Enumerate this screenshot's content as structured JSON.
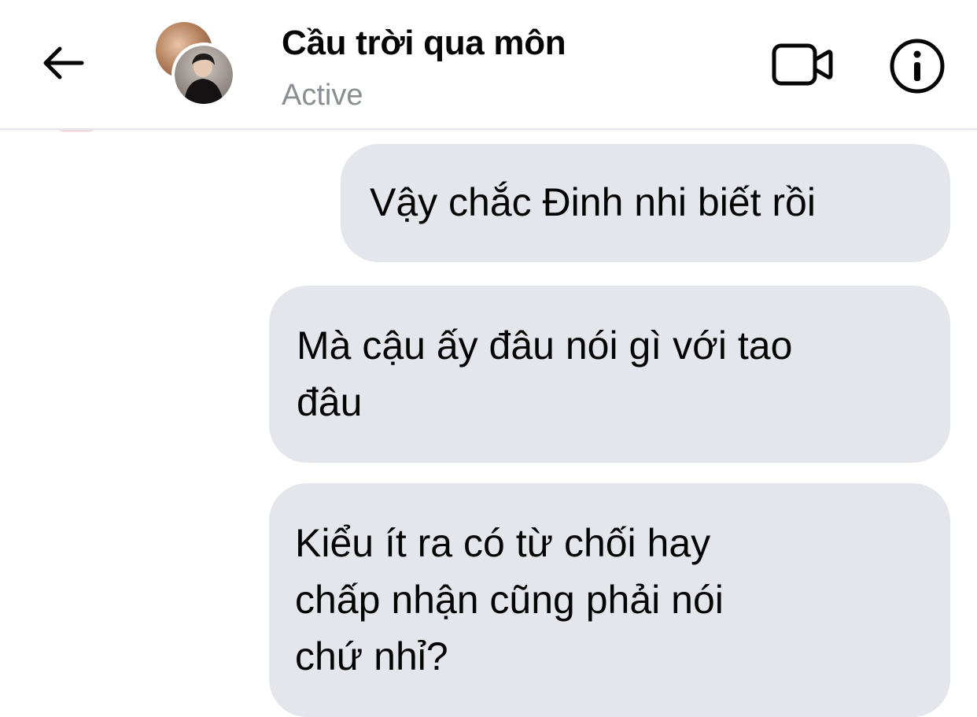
{
  "header": {
    "title": "Cầu trời qua môn",
    "status": "Active",
    "back_icon": "arrow-left-icon",
    "video_icon": "video-camera-icon",
    "info_icon": "info-icon"
  },
  "messages": [
    {
      "sender": "me",
      "lines": [
        "Vậy chắc Đinh nhi biết rồi"
      ]
    },
    {
      "sender": "me",
      "lines": [
        "Mà cậu ấy đâu nói gì với tao",
        "đâu"
      ]
    },
    {
      "sender": "me",
      "lines": [
        "Kiểu ít ra có từ chối hay",
        "chấp nhận cũng phải nói",
        "chứ nhỉ?"
      ]
    }
  ],
  "colors": {
    "bubble": "#e4e6eb",
    "text": "#050505",
    "status": "#8a8d91"
  }
}
